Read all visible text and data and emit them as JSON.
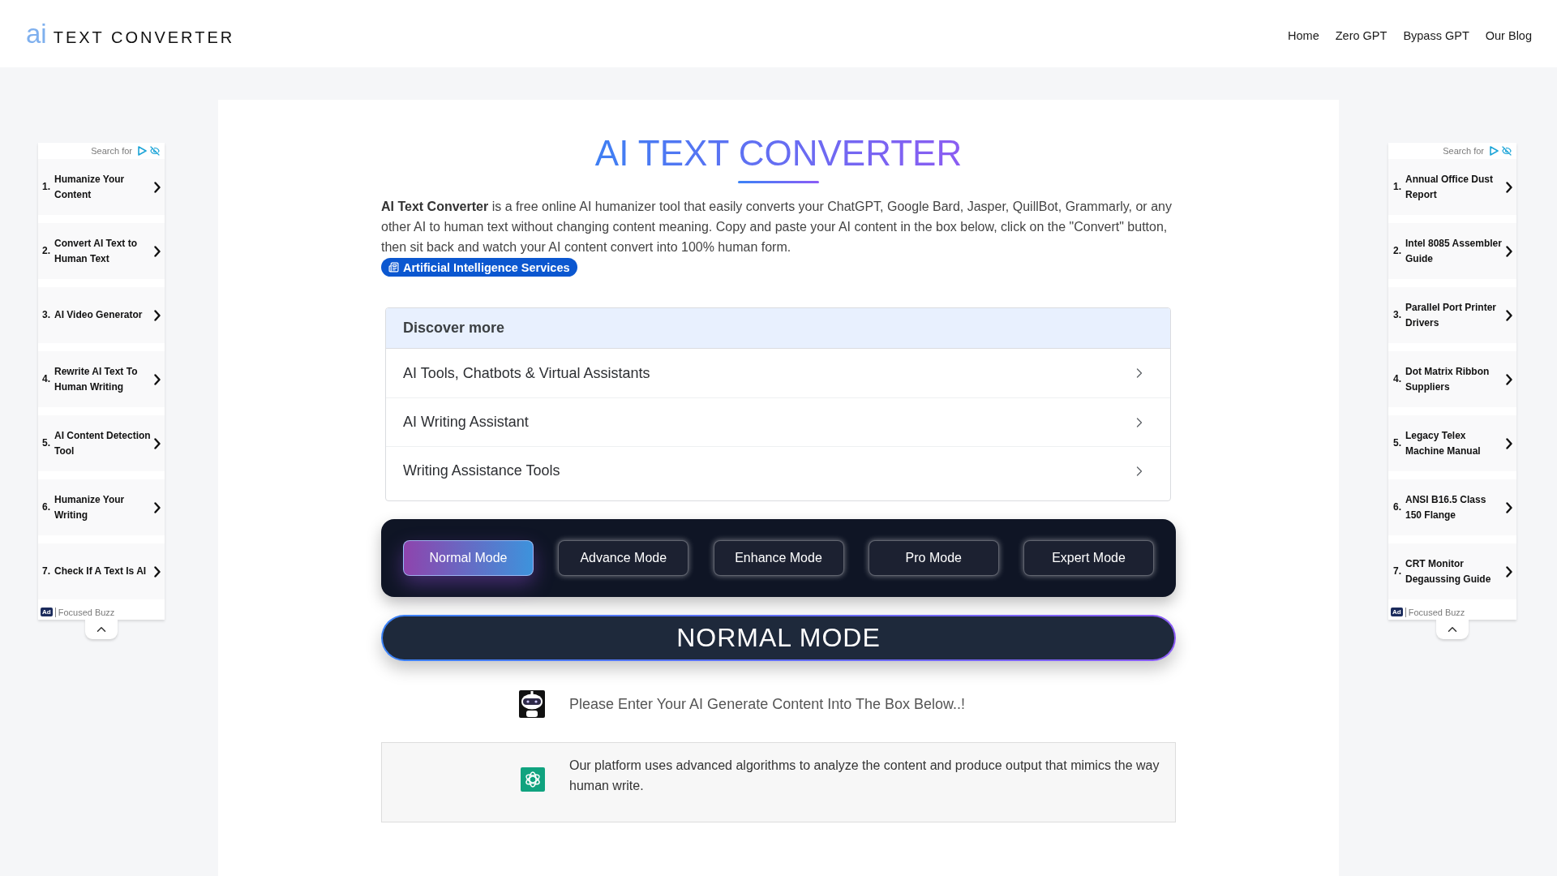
{
  "header": {
    "logo": {
      "mark": "ai",
      "text": "TEXT CONVERTER"
    },
    "nav": [
      "Home",
      "Zero GPT",
      "Bypass GPT",
      "Our Blog"
    ]
  },
  "left_ad": {
    "search_label": "Search for",
    "items": [
      {
        "number": "1.",
        "label": "Humanize Your Content"
      },
      {
        "number": "2.",
        "label": "Convert AI Text to Human Text"
      },
      {
        "number": "3.",
        "label": "AI Video Generator"
      },
      {
        "number": "4.",
        "label": "Rewrite AI Text To Human Writing"
      },
      {
        "number": "5.",
        "label": "AI Content Detection Tool"
      },
      {
        "number": "6.",
        "label": "Humanize Your Writing"
      },
      {
        "number": "7.",
        "label": "Check If A Text Is AI"
      }
    ],
    "ad_badge": "Ad",
    "sponsor": "Focused Buzz"
  },
  "main": {
    "title": "AI TEXT CONVERTER",
    "description": "**AI Text Converter** is a free online AI humanizer tool that easily converts your ChatGPT, Google Bard, Jasper, QuillBot, Grammarly, or any other AI to human text without changing content meaning. Copy and paste your AI content in the box below, click on the \"Convert\" button, then sit back and watch your AI content convert into 100% human form.",
    "category_badge": "Artificial Intelligence Services",
    "discover": {
      "heading": "Discover more",
      "items": [
        "AI Tools, Chatbots & Virtual Assistants",
        "AI Writing Assistant",
        "Writing Assistance Tools"
      ]
    },
    "modes": [
      {
        "label": "Normal Mode",
        "selected": true
      },
      {
        "label": "Advance Mode",
        "selected": false
      },
      {
        "label": "Enhance Mode",
        "selected": false
      },
      {
        "label": "Pro Mode",
        "selected": false
      },
      {
        "label": "Expert Mode",
        "selected": false
      }
    ],
    "mode_heading": "NORMAL MODE",
    "prompt": "Please Enter Your AI Generate Content Into The Box Below..!",
    "info": "Our platform uses advanced algorithms to analyze the content and produce output that mimics the way human write."
  },
  "right_ad": {
    "search_label": "Search for",
    "items": [
      {
        "number": "1.",
        "label": "Annual Office Dust Report"
      },
      {
        "number": "2.",
        "label": "Intel 8085 Assembler Guide"
      },
      {
        "number": "3.",
        "label": "Parallel Port Printer Drivers"
      },
      {
        "number": "4.",
        "label": "Dot Matrix Ribbon Suppliers"
      },
      {
        "number": "5.",
        "label": "Legacy Telex Machine Manual"
      },
      {
        "number": "6.",
        "label": "ANSI B16.5 Class 150 Flange"
      },
      {
        "number": "7.",
        "label": "CRT Monitor Degaussing Guide"
      }
    ],
    "ad_badge": "Ad",
    "sponsor": "Focused Buzz"
  }
}
